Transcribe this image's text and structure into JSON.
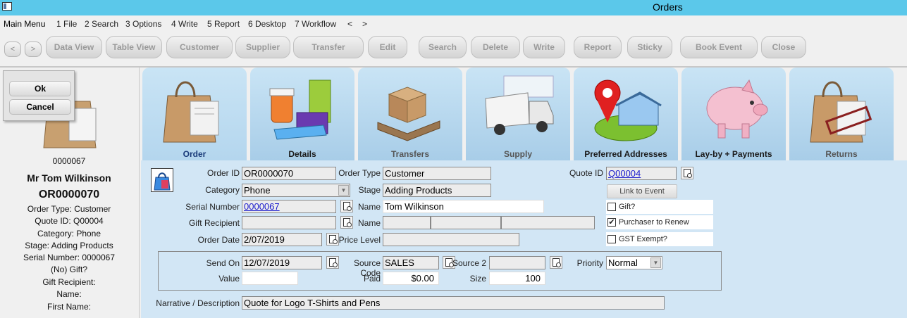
{
  "window": {
    "title": "Orders"
  },
  "menu": {
    "items": [
      "Main Menu",
      "1 File",
      "2 Search",
      "3 Options",
      "4 Write",
      "5 Report",
      "6 Desktop",
      "7 Workflow",
      "<",
      ">"
    ]
  },
  "toolbar": {
    "nav_prev": "<",
    "nav_next": ">",
    "buttons": [
      "Data View",
      "Table View",
      "Customer",
      "Supplier",
      "Transfer",
      "Edit",
      "Search",
      "Delete",
      "Write",
      "Report",
      "Sticky",
      "Book Event",
      "Close"
    ]
  },
  "dialog": {
    "ok": "Ok",
    "cancel": "Cancel"
  },
  "summary": {
    "number": "0000067",
    "name": "Mr Tom Wilkinson",
    "order_id": "OR0000070",
    "lines": [
      "Order Type: Customer",
      "Quote ID: Q00004",
      "Category: Phone",
      "Stage: Adding Products",
      "Serial Number: 0000067",
      "(No) Gift?",
      "Gift Recipient:",
      "Name:",
      "First Name:"
    ]
  },
  "tabs": [
    "Order",
    "Details",
    "Transfers",
    "Supply",
    "Preferred Addresses",
    "Lay-by + Payments",
    "Returns"
  ],
  "form": {
    "order_id_label": "Order ID",
    "order_id": "OR0000070",
    "order_type_label": "Order Type",
    "order_type": "Customer",
    "quote_id_label": "Quote ID",
    "quote_id": "Q00004",
    "category_label": "Category",
    "category": "Phone",
    "stage_label": "Stage",
    "stage": "Adding Products",
    "link_to_event": "Link to Event",
    "serial_label": "Serial Number",
    "serial": "0000067",
    "name_label": "Name",
    "name": "Tom Wilkinson",
    "gift": "Gift?",
    "gift_recipient_label": "Gift Recipient",
    "name2_label": "Name",
    "purchaser_renew": "Purchaser to Renew",
    "order_date_label": "Order Date",
    "order_date": "2/07/2019",
    "price_level_label": "Price Level",
    "gst_exempt": "GST Exempt?",
    "send_on_label": "Send On",
    "send_on": "12/07/2019",
    "source_code_label": "Source Code",
    "source_code": "SALES",
    "source2_label": "Source 2",
    "priority_label": "Priority",
    "priority": "Normal",
    "value_label": "Value",
    "paid_label": "Paid",
    "paid": "$0.00",
    "size_label": "Size",
    "size": "100",
    "narrative_label": "Narrative / Description",
    "narrative": "Quote for Logo T-Shirts and Pens"
  }
}
